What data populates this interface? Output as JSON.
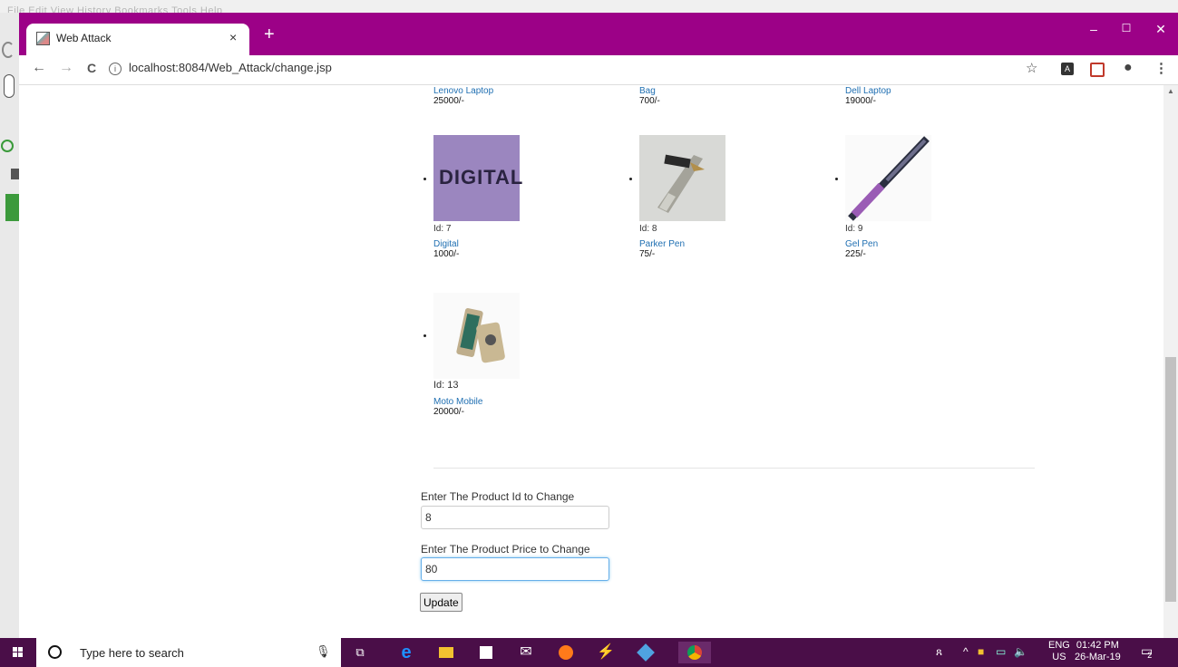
{
  "background_app": {
    "menu": "File  Edit  View  History  Bookmarks  Tools  Help"
  },
  "browser": {
    "tab_title": "Web Attack",
    "tab_close": "×",
    "new_tab": "+",
    "window_controls": {
      "minimize": "–",
      "maximize": "☐",
      "close": "✕"
    },
    "url": "localhost:8084/Web_Attack/change.jsp",
    "nav": {
      "back": "←",
      "forward": "→",
      "reload": "C"
    },
    "star": "☆",
    "account": "●",
    "menu": "⋮"
  },
  "products_top_row": [
    {
      "name": "Lenovo Laptop",
      "price": "25000/-"
    },
    {
      "name": "Bag",
      "price": "700/-"
    },
    {
      "name": "Dell Laptop",
      "price": "19000/-"
    }
  ],
  "products": [
    {
      "id_label": "Id: 7",
      "name": "Digital",
      "price": "1000/-",
      "thumb_text": "DIGITAL"
    },
    {
      "id_label": "Id: 8",
      "name": "Parker Pen",
      "price": "75/-"
    },
    {
      "id_label": "Id: 9",
      "name": "Gel Pen",
      "price": "225/-"
    },
    {
      "id_label": "Id: 13",
      "name": "Moto Mobile",
      "price": "20000/-"
    }
  ],
  "form": {
    "id_label": "Enter The Product Id to Change",
    "id_value": "8",
    "price_label": "Enter The Product Price to Change",
    "price_value": "80",
    "submit_label": "Update"
  },
  "taskbar": {
    "search_placeholder": "Type here to search",
    "lang_top": "ENG",
    "lang_bottom": "US",
    "time": "01:42 PM",
    "date": "26-Mar-19",
    "notification_count": "2"
  },
  "colors": {
    "titlebar": "#9c0187",
    "taskbar": "#4a0e48",
    "link": "#1f6fb2"
  }
}
